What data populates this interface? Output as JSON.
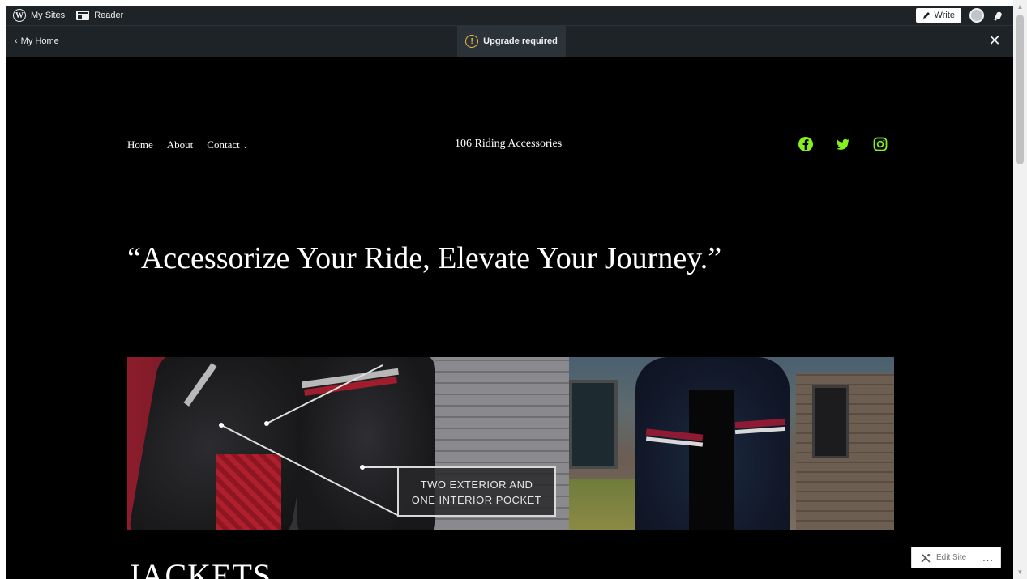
{
  "admin_bar": {
    "my_sites": "My Sites",
    "reader": "Reader",
    "write": "Write"
  },
  "sub_bar": {
    "back_label": "My Home",
    "upgrade_label": "Upgrade required",
    "warn_glyph": "!",
    "close_glyph": "✕"
  },
  "site": {
    "nav": [
      "Home",
      "About",
      "Contact"
    ],
    "title": "106 Riding Accessories",
    "social_icons": [
      "facebook-icon",
      "twitter-icon",
      "instagram-icon"
    ],
    "accent_color": "#84f01f",
    "quote": "“Accessorize Your Ride, Elevate Your Journey.”",
    "banner_callout_line1": "TWO EXTERIOR AND",
    "banner_callout_line2": "ONE INTERIOR POCKET",
    "section_heading": "JACKETS"
  },
  "edit_site": {
    "label": "Edit Site",
    "more": "..."
  }
}
